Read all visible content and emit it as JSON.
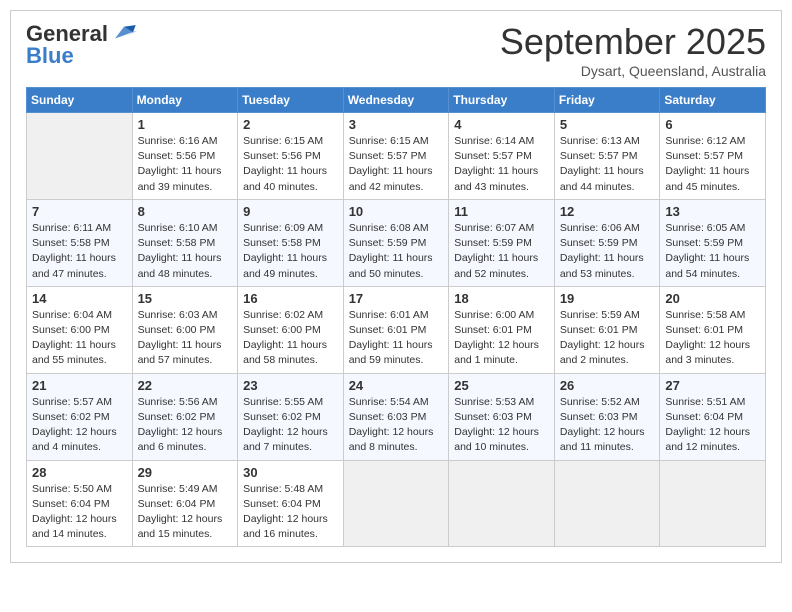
{
  "header": {
    "logo_general": "General",
    "logo_blue": "Blue",
    "month": "September 2025",
    "location": "Dysart, Queensland, Australia"
  },
  "days_of_week": [
    "Sunday",
    "Monday",
    "Tuesday",
    "Wednesday",
    "Thursday",
    "Friday",
    "Saturday"
  ],
  "weeks": [
    [
      {
        "day": "",
        "info": ""
      },
      {
        "day": "1",
        "info": "Sunrise: 6:16 AM\nSunset: 5:56 PM\nDaylight: 11 hours\nand 39 minutes."
      },
      {
        "day": "2",
        "info": "Sunrise: 6:15 AM\nSunset: 5:56 PM\nDaylight: 11 hours\nand 40 minutes."
      },
      {
        "day": "3",
        "info": "Sunrise: 6:15 AM\nSunset: 5:57 PM\nDaylight: 11 hours\nand 42 minutes."
      },
      {
        "day": "4",
        "info": "Sunrise: 6:14 AM\nSunset: 5:57 PM\nDaylight: 11 hours\nand 43 minutes."
      },
      {
        "day": "5",
        "info": "Sunrise: 6:13 AM\nSunset: 5:57 PM\nDaylight: 11 hours\nand 44 minutes."
      },
      {
        "day": "6",
        "info": "Sunrise: 6:12 AM\nSunset: 5:57 PM\nDaylight: 11 hours\nand 45 minutes."
      }
    ],
    [
      {
        "day": "7",
        "info": "Sunrise: 6:11 AM\nSunset: 5:58 PM\nDaylight: 11 hours\nand 47 minutes."
      },
      {
        "day": "8",
        "info": "Sunrise: 6:10 AM\nSunset: 5:58 PM\nDaylight: 11 hours\nand 48 minutes."
      },
      {
        "day": "9",
        "info": "Sunrise: 6:09 AM\nSunset: 5:58 PM\nDaylight: 11 hours\nand 49 minutes."
      },
      {
        "day": "10",
        "info": "Sunrise: 6:08 AM\nSunset: 5:59 PM\nDaylight: 11 hours\nand 50 minutes."
      },
      {
        "day": "11",
        "info": "Sunrise: 6:07 AM\nSunset: 5:59 PM\nDaylight: 11 hours\nand 52 minutes."
      },
      {
        "day": "12",
        "info": "Sunrise: 6:06 AM\nSunset: 5:59 PM\nDaylight: 11 hours\nand 53 minutes."
      },
      {
        "day": "13",
        "info": "Sunrise: 6:05 AM\nSunset: 5:59 PM\nDaylight: 11 hours\nand 54 minutes."
      }
    ],
    [
      {
        "day": "14",
        "info": "Sunrise: 6:04 AM\nSunset: 6:00 PM\nDaylight: 11 hours\nand 55 minutes."
      },
      {
        "day": "15",
        "info": "Sunrise: 6:03 AM\nSunset: 6:00 PM\nDaylight: 11 hours\nand 57 minutes."
      },
      {
        "day": "16",
        "info": "Sunrise: 6:02 AM\nSunset: 6:00 PM\nDaylight: 11 hours\nand 58 minutes."
      },
      {
        "day": "17",
        "info": "Sunrise: 6:01 AM\nSunset: 6:01 PM\nDaylight: 11 hours\nand 59 minutes."
      },
      {
        "day": "18",
        "info": "Sunrise: 6:00 AM\nSunset: 6:01 PM\nDaylight: 12 hours\nand 1 minute."
      },
      {
        "day": "19",
        "info": "Sunrise: 5:59 AM\nSunset: 6:01 PM\nDaylight: 12 hours\nand 2 minutes."
      },
      {
        "day": "20",
        "info": "Sunrise: 5:58 AM\nSunset: 6:01 PM\nDaylight: 12 hours\nand 3 minutes."
      }
    ],
    [
      {
        "day": "21",
        "info": "Sunrise: 5:57 AM\nSunset: 6:02 PM\nDaylight: 12 hours\nand 4 minutes."
      },
      {
        "day": "22",
        "info": "Sunrise: 5:56 AM\nSunset: 6:02 PM\nDaylight: 12 hours\nand 6 minutes."
      },
      {
        "day": "23",
        "info": "Sunrise: 5:55 AM\nSunset: 6:02 PM\nDaylight: 12 hours\nand 7 minutes."
      },
      {
        "day": "24",
        "info": "Sunrise: 5:54 AM\nSunset: 6:03 PM\nDaylight: 12 hours\nand 8 minutes."
      },
      {
        "day": "25",
        "info": "Sunrise: 5:53 AM\nSunset: 6:03 PM\nDaylight: 12 hours\nand 10 minutes."
      },
      {
        "day": "26",
        "info": "Sunrise: 5:52 AM\nSunset: 6:03 PM\nDaylight: 12 hours\nand 11 minutes."
      },
      {
        "day": "27",
        "info": "Sunrise: 5:51 AM\nSunset: 6:04 PM\nDaylight: 12 hours\nand 12 minutes."
      }
    ],
    [
      {
        "day": "28",
        "info": "Sunrise: 5:50 AM\nSunset: 6:04 PM\nDaylight: 12 hours\nand 14 minutes."
      },
      {
        "day": "29",
        "info": "Sunrise: 5:49 AM\nSunset: 6:04 PM\nDaylight: 12 hours\nand 15 minutes."
      },
      {
        "day": "30",
        "info": "Sunrise: 5:48 AM\nSunset: 6:04 PM\nDaylight: 12 hours\nand 16 minutes."
      },
      {
        "day": "",
        "info": ""
      },
      {
        "day": "",
        "info": ""
      },
      {
        "day": "",
        "info": ""
      },
      {
        "day": "",
        "info": ""
      }
    ]
  ]
}
